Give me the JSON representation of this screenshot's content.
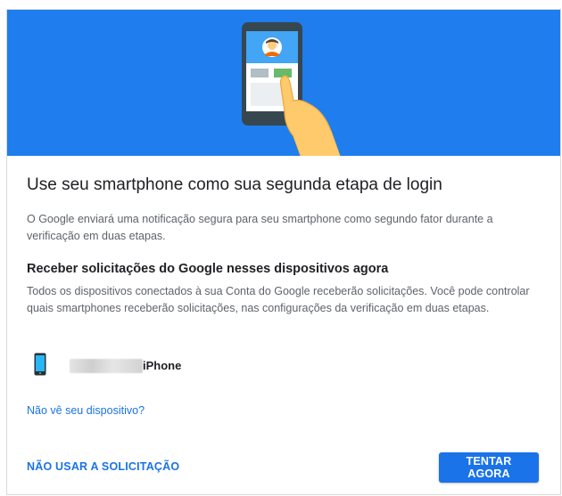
{
  "colors": {
    "hero_bg": "#1f7ded",
    "accent": "#1a73e8",
    "text": "#202124",
    "muted": "#5f6368"
  },
  "hero": {
    "illustration": "hand-holding-phone-illustration"
  },
  "title": "Use seu smartphone como sua segunda etapa de login",
  "description": "O Google enviará uma notificação segura para seu smartphone como segundo fator durante a verificação em duas etapas.",
  "subtitle": "Receber solicitações do Google nesses dispositivos agora",
  "description2": "Todos os dispositivos conectados à sua Conta do Google receberão solicitações. Você pode controlar quais smartphones receberão solicitações, nas configurações da verificação em duas etapas.",
  "device": {
    "icon": "smartphone-icon",
    "name": "iPhone"
  },
  "link_text": "Não vê seu dispositivo?",
  "actions": {
    "skip_label": "NÃO USAR A SOLICITAÇÃO",
    "try_label": "TENTAR AGORA"
  }
}
